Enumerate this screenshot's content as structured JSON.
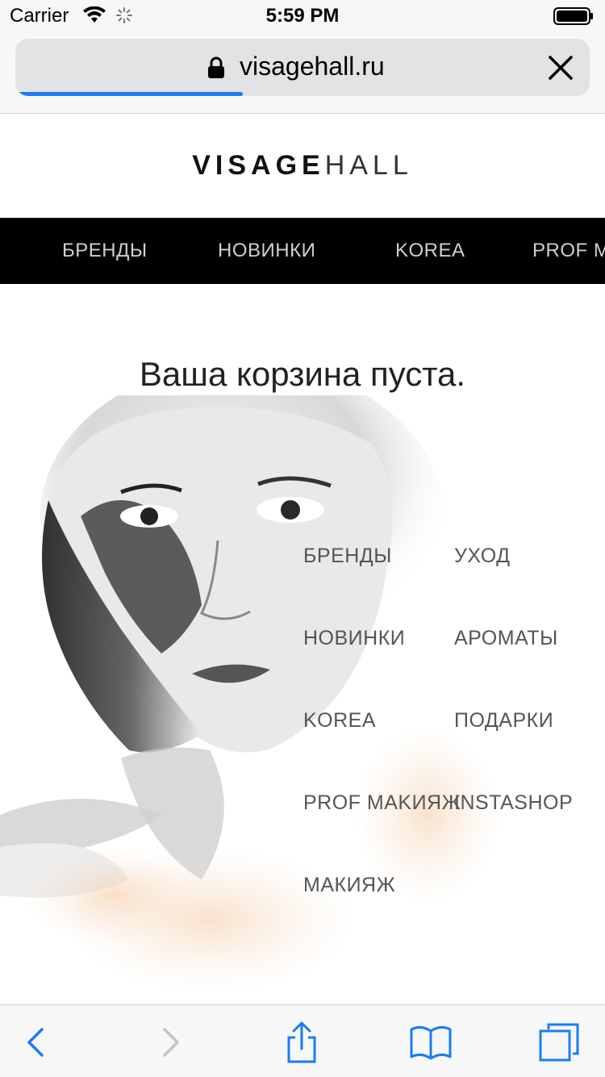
{
  "status_bar": {
    "carrier": "Carrier",
    "time": "5:59 PM"
  },
  "browser": {
    "url": "visagehall.ru",
    "load_progress": 0.39
  },
  "site": {
    "logo_bold": "VISAGE",
    "logo_light": "HALL",
    "top_nav": [
      "БРЕНДЫ",
      "НОВИНКИ",
      "KOREA",
      "PROF MAKИЯЖ"
    ],
    "cart_message": "Ваша корзина пуста.",
    "menu_left": [
      "БРЕНДЫ",
      "НОВИНКИ",
      "KOREA",
      "PROF MAKИЯЖ",
      "МАКИЯЖ"
    ],
    "menu_right": [
      "УХОД",
      "АРОМАТЫ",
      "ПОДАРКИ",
      "INSTASHOP"
    ]
  },
  "toolbar": {
    "icons": [
      "back-icon",
      "forward-icon",
      "share-icon",
      "bookmarks-icon",
      "tabs-icon"
    ]
  },
  "colors": {
    "accent": "#1a7cf5",
    "nav_bg": "#000000"
  }
}
